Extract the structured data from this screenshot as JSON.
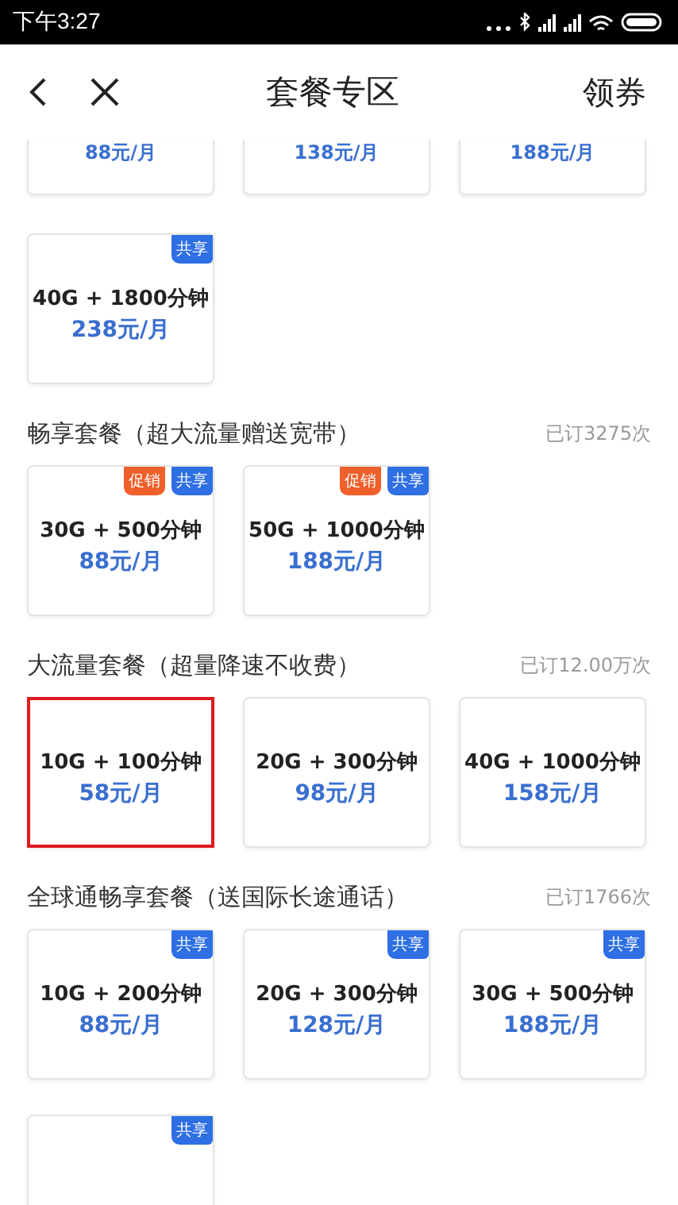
{
  "status_bar": {
    "time": "下午3:27"
  },
  "header": {
    "title": "套餐专区",
    "action": "领券"
  },
  "top_cards": [
    {
      "price": "88元/月"
    },
    {
      "price": "138元/月"
    },
    {
      "price": "188元/月"
    }
  ],
  "sections": [
    {
      "cards": [
        {
          "plan": "40G + 1800分钟",
          "price": "238元/月",
          "selected": false,
          "tags": [
            {
              "kind": "shared",
              "label": "共享"
            }
          ]
        }
      ]
    },
    {
      "title": "畅享套餐（超大流量赠送宽带）",
      "count": "已订3275次",
      "cards": [
        {
          "plan": "30G + 500分钟",
          "price": "88元/月",
          "selected": false,
          "tags": [
            {
              "kind": "promo",
              "label": "促销"
            },
            {
              "kind": "shared",
              "label": "共享"
            }
          ]
        },
        {
          "plan": "50G + 1000分钟",
          "price": "188元/月",
          "selected": false,
          "tags": [
            {
              "kind": "promo",
              "label": "促销"
            },
            {
              "kind": "shared",
              "label": "共享"
            }
          ]
        }
      ]
    },
    {
      "title": "大流量套餐（超量降速不收费）",
      "count": "已订12.00万次",
      "cards": [
        {
          "plan": "10G + 100分钟",
          "price": "58元/月",
          "selected": true
        },
        {
          "plan": "20G + 300分钟",
          "price": "98元/月",
          "selected": false
        },
        {
          "plan": "40G + 1000分钟",
          "price": "158元/月",
          "selected": false
        }
      ]
    },
    {
      "title": "全球通畅享套餐（送国际长途通话）",
      "count": "已订1766次",
      "cards": [
        {
          "plan": "10G + 200分钟",
          "price": "88元/月",
          "selected": false,
          "tags": [
            {
              "kind": "shared",
              "label": "共享"
            }
          ]
        },
        {
          "plan": "20G + 300分钟",
          "price": "128元/月",
          "selected": false,
          "tags": [
            {
              "kind": "shared",
              "label": "共享"
            }
          ]
        },
        {
          "plan": "30G + 500分钟",
          "price": "188元/月",
          "selected": false,
          "tags": [
            {
              "kind": "shared",
              "label": "共享"
            }
          ]
        },
        {
          "selected": false,
          "tags": [
            {
              "kind": "shared",
              "label": "共享"
            }
          ]
        }
      ]
    }
  ]
}
